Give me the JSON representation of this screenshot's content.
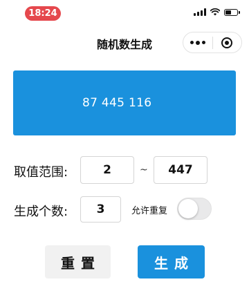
{
  "status_bar": {
    "time": "18:24",
    "time_pill_color": "#e5484d",
    "icons": [
      "signal-icon",
      "wifi-icon",
      "battery-icon"
    ],
    "battery_level": 0.55
  },
  "nav": {
    "title": "随机数生成",
    "capsule_icons": [
      "more-dots-icon",
      "close-target-icon"
    ]
  },
  "result": {
    "numbers": "87  445  116",
    "background_color": "#1a91dd"
  },
  "range": {
    "label": "取值范围:",
    "min": "2",
    "separator": "~",
    "max": "447"
  },
  "count": {
    "label": "生成个数:",
    "value": "3"
  },
  "allow_repeat": {
    "label": "允许重复",
    "enabled": false
  },
  "buttons": {
    "reset": "重置",
    "generate": "生成",
    "generate_color": "#1a91dd"
  }
}
